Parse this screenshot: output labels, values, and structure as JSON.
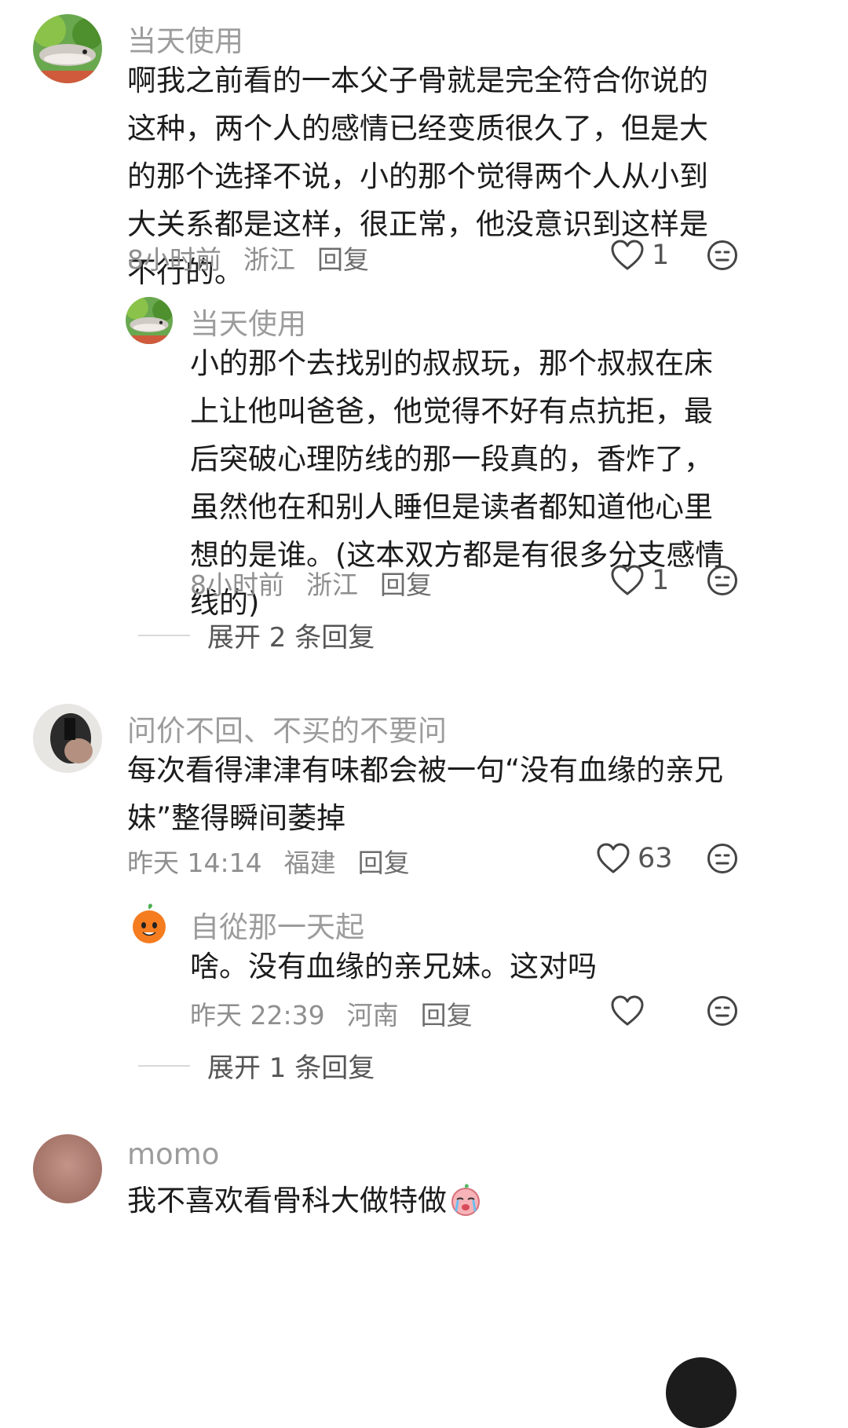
{
  "comments": [
    {
      "username": "当天使用",
      "text": "啊我之前看的一本父子骨就是完全符合你说的这种，两个人的感情已经变质很久了，但是大的那个选择不说，小的那个觉得两个人从小到大关系都是这样，很正常，他没意识到这样是不行的。",
      "time": "8小时前",
      "location": "浙江",
      "reply_label": "回复",
      "likes": "1",
      "replies": [
        {
          "username": "当天使用",
          "text": "小的那个去找别的叔叔玩，那个叔叔在床上让他叫爸爸，他觉得不好有点抗拒，最后突破心理防线的那一段真的，香炸了，虽然他在和别人睡但是读者都知道他心里想的是谁。(这本双方都是有很多分支感情线的)",
          "time": "8小时前",
          "location": "浙江",
          "reply_label": "回复",
          "likes": "1"
        }
      ],
      "expand_label": "展开 2 条回复"
    },
    {
      "username": "问价不回、不买的不要问",
      "text": "每次看得津津有味都会被一句“没有血缘的亲兄妹”整得瞬间萎掉",
      "time": "昨天 14:14",
      "location": "福建",
      "reply_label": "回复",
      "likes": "63",
      "replies": [
        {
          "username": "自從那一天起",
          "text": "啥。没有血缘的亲兄妹。这对吗",
          "time": "昨天 22:39",
          "location": "河南",
          "reply_label": "回复",
          "likes": ""
        }
      ],
      "expand_label": "展开 1 条回复"
    },
    {
      "username": "momo",
      "text": "我不喜欢看骨科大做特做",
      "emoji": "crying-face-emoji"
    }
  ],
  "icons": {
    "like": "heart-outline-icon",
    "dislike": "neutral-face-icon"
  },
  "colors": {
    "text": "#1c1c1c",
    "username": "#9c9c9c",
    "meta": "#8f8f8f"
  }
}
